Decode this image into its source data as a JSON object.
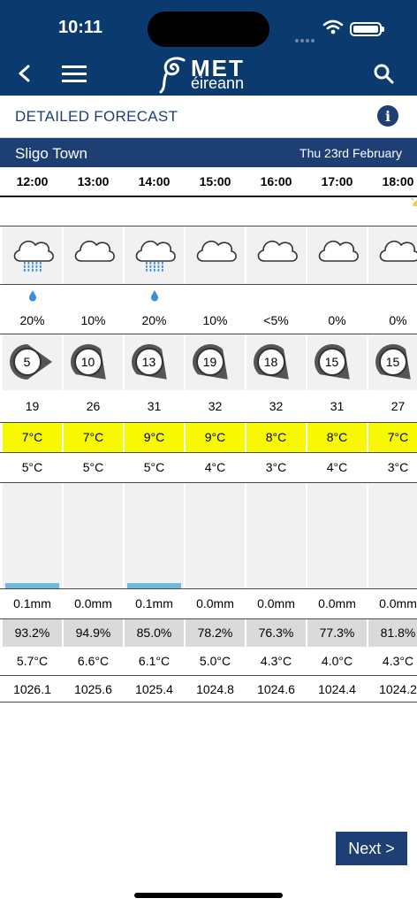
{
  "status": {
    "time": "10:11"
  },
  "nav": {
    "logo_top": "MET",
    "logo_bottom": "éireann"
  },
  "page": {
    "title": "DETAILED FORECAST"
  },
  "location": {
    "name": "Sligo Town",
    "date": "Thu 23rd February"
  },
  "colors": {
    "brand_navy": "#0b3a6e",
    "header_blue": "#1d3f73",
    "max_temp_highlight": "#f8f800",
    "rain_bar": "#6fbadc"
  },
  "icons": {
    "back": "chevron-left-icon",
    "menu": "hamburger-menu-icon",
    "search": "search-icon",
    "info": "info-icon"
  },
  "forecast": [
    {
      "hour": "12:00",
      "weather": "cloud-rain",
      "drop": true,
      "precip_prob": "20%",
      "wind_dir": "E",
      "wind_speed": "5",
      "gust": "19",
      "max_temp": "7°C",
      "min_temp": "5°C",
      "rain_level": 0.05,
      "rain": "0.1mm",
      "humidity": "93.2%",
      "dew_point": "5.7°C",
      "pressure": "1026.1"
    },
    {
      "hour": "13:00",
      "weather": "cloud",
      "drop": false,
      "precip_prob": "10%",
      "wind_dir": "SE",
      "wind_speed": "10",
      "gust": "26",
      "max_temp": "7°C",
      "min_temp": "5°C",
      "rain_level": 0,
      "rain": "0.0mm",
      "humidity": "94.9%",
      "dew_point": "6.6°C",
      "pressure": "1025.6"
    },
    {
      "hour": "14:00",
      "weather": "cloud-rain",
      "drop": true,
      "precip_prob": "20%",
      "wind_dir": "SE",
      "wind_speed": "13",
      "gust": "31",
      "max_temp": "9°C",
      "min_temp": "5°C",
      "rain_level": 0.05,
      "rain": "0.1mm",
      "humidity": "85.0%",
      "dew_point": "6.1°C",
      "pressure": "1025.4"
    },
    {
      "hour": "15:00",
      "weather": "cloud",
      "drop": false,
      "precip_prob": "10%",
      "wind_dir": "SE",
      "wind_speed": "19",
      "gust": "32",
      "max_temp": "9°C",
      "min_temp": "4°C",
      "rain_level": 0,
      "rain": "0.0mm",
      "humidity": "78.2%",
      "dew_point": "5.0°C",
      "pressure": "1024.8"
    },
    {
      "hour": "16:00",
      "weather": "cloud",
      "drop": false,
      "precip_prob": "<5%",
      "wind_dir": "SE",
      "wind_speed": "18",
      "gust": "32",
      "max_temp": "8°C",
      "min_temp": "3°C",
      "rain_level": 0,
      "rain": "0.0mm",
      "humidity": "76.3%",
      "dew_point": "4.3°C",
      "pressure": "1024.6"
    },
    {
      "hour": "17:00",
      "weather": "cloud",
      "drop": false,
      "precip_prob": "0%",
      "wind_dir": "SE",
      "wind_speed": "15",
      "gust": "31",
      "max_temp": "8°C",
      "min_temp": "4°C",
      "rain_level": 0,
      "rain": "0.0mm",
      "humidity": "77.3%",
      "dew_point": "4.0°C",
      "pressure": "1024.4"
    },
    {
      "hour": "18:00",
      "weather": "cloud",
      "drop": false,
      "precip_prob": "0%",
      "wind_dir": "SE",
      "wind_speed": "15",
      "gust": "27",
      "max_temp": "7°C",
      "min_temp": "3°C",
      "rain_level": 0,
      "rain": "0.0mm",
      "humidity": "81.8%",
      "dew_point": "4.3°C",
      "pressure": "1024.2",
      "sunset": true
    }
  ],
  "buttons": {
    "next": "Next >"
  }
}
